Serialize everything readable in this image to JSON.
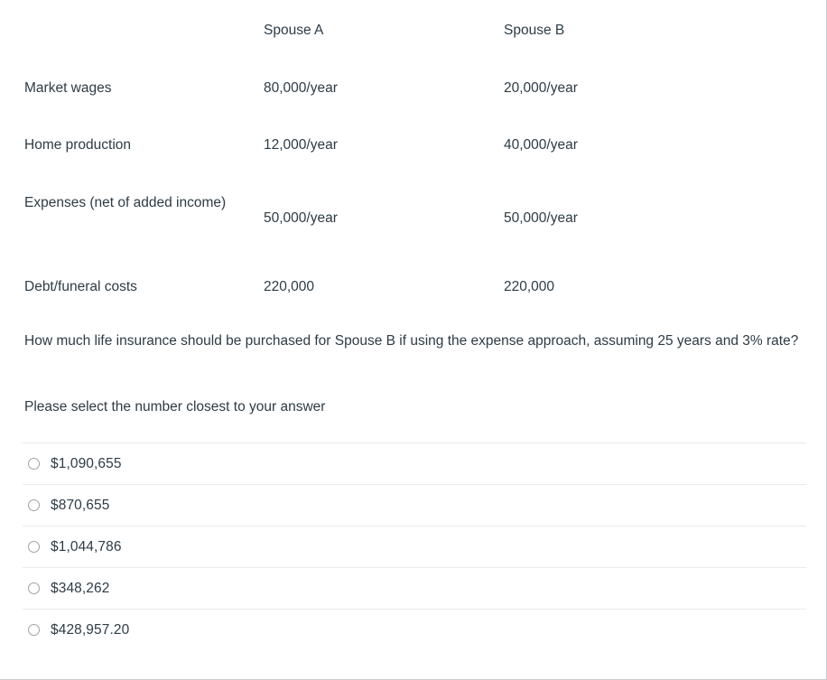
{
  "table": {
    "headers": [
      "",
      "Spouse A",
      "Spouse B"
    ],
    "rows": [
      {
        "label": "Market wages",
        "spouse_a": "80,000/year",
        "spouse_b": "20,000/year"
      },
      {
        "label": "Home production",
        "spouse_a": "12,000/year",
        "spouse_b": "40,000/year"
      },
      {
        "label": "Expenses (net of added income)",
        "spouse_a": "50,000/year",
        "spouse_b": "50,000/year"
      },
      {
        "label": "Debt/funeral costs",
        "spouse_a": "220,000",
        "spouse_b": "220,000"
      }
    ]
  },
  "question": {
    "text": "How much life insurance should be purchased for Spouse B if using the expense approach, assuming 25 years and 3% rate?",
    "instruction": "Please select the number closest to your answer"
  },
  "answers": [
    {
      "label": "$1,090,655"
    },
    {
      "label": "$870,655"
    },
    {
      "label": "$1,044,786"
    },
    {
      "label": "$348,262"
    },
    {
      "label": "$428,957.20"
    }
  ],
  "colors": {
    "text": "#2d3b45",
    "separator": "#e8eaec",
    "border": "#c7cdd1",
    "radio_border": "#9ba2a8",
    "background": "#ffffff"
  }
}
